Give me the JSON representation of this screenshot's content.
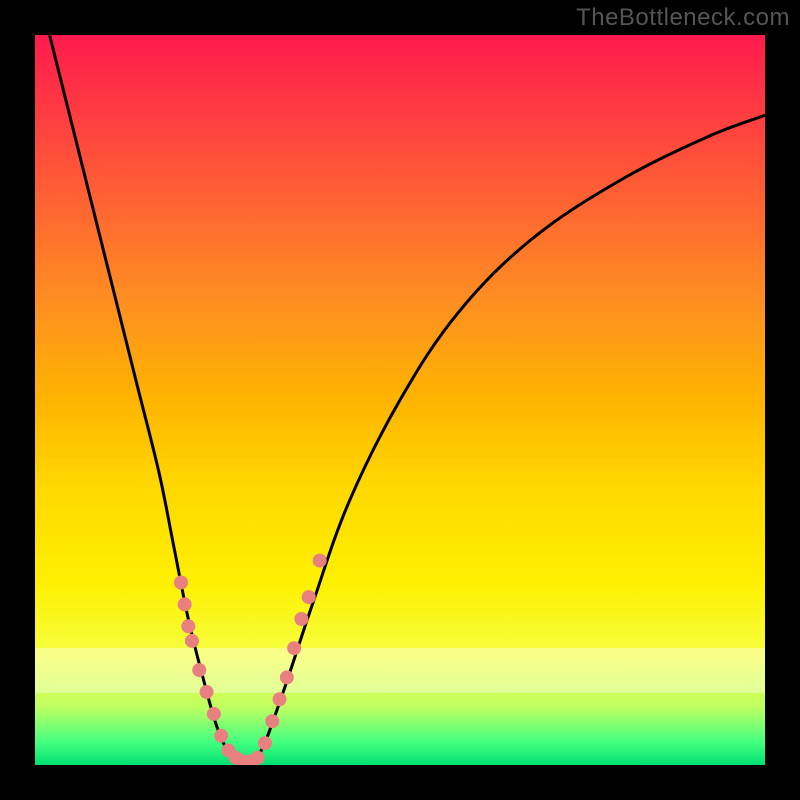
{
  "watermark": "TheBottleneck.com",
  "chart_data": {
    "type": "line",
    "title": "",
    "xlabel": "",
    "ylabel": "",
    "x_range": [
      0,
      100
    ],
    "y_range": [
      0,
      100
    ],
    "curve": {
      "left_branch": [
        {
          "x": 2,
          "y": 100
        },
        {
          "x": 5,
          "y": 88
        },
        {
          "x": 8,
          "y": 76
        },
        {
          "x": 11,
          "y": 64
        },
        {
          "x": 14,
          "y": 52
        },
        {
          "x": 17,
          "y": 40
        },
        {
          "x": 19,
          "y": 30
        },
        {
          "x": 21,
          "y": 20
        },
        {
          "x": 23,
          "y": 12
        },
        {
          "x": 25,
          "y": 5
        },
        {
          "x": 27,
          "y": 1
        },
        {
          "x": 29,
          "y": 0
        }
      ],
      "right_branch": [
        {
          "x": 29,
          "y": 0
        },
        {
          "x": 31,
          "y": 2
        },
        {
          "x": 34,
          "y": 10
        },
        {
          "x": 38,
          "y": 22
        },
        {
          "x": 43,
          "y": 36
        },
        {
          "x": 50,
          "y": 50
        },
        {
          "x": 58,
          "y": 62
        },
        {
          "x": 68,
          "y": 72
        },
        {
          "x": 80,
          "y": 80
        },
        {
          "x": 92,
          "y": 86
        },
        {
          "x": 100,
          "y": 89
        }
      ]
    },
    "markers": [
      {
        "x": 20.0,
        "y": 25
      },
      {
        "x": 20.5,
        "y": 22
      },
      {
        "x": 21.0,
        "y": 19
      },
      {
        "x": 21.5,
        "y": 17
      },
      {
        "x": 22.5,
        "y": 13
      },
      {
        "x": 23.5,
        "y": 10
      },
      {
        "x": 24.5,
        "y": 7
      },
      {
        "x": 25.5,
        "y": 4
      },
      {
        "x": 26.5,
        "y": 2
      },
      {
        "x": 27.5,
        "y": 1
      },
      {
        "x": 28.5,
        "y": 0.5
      },
      {
        "x": 29.5,
        "y": 0.5
      },
      {
        "x": 30.5,
        "y": 1
      },
      {
        "x": 31.5,
        "y": 3
      },
      {
        "x": 32.5,
        "y": 6
      },
      {
        "x": 33.5,
        "y": 9
      },
      {
        "x": 34.5,
        "y": 12
      },
      {
        "x": 35.5,
        "y": 16
      },
      {
        "x": 36.5,
        "y": 20
      },
      {
        "x": 37.5,
        "y": 23
      },
      {
        "x": 39.0,
        "y": 28
      }
    ],
    "watermark_band_y": [
      10,
      16
    ]
  }
}
